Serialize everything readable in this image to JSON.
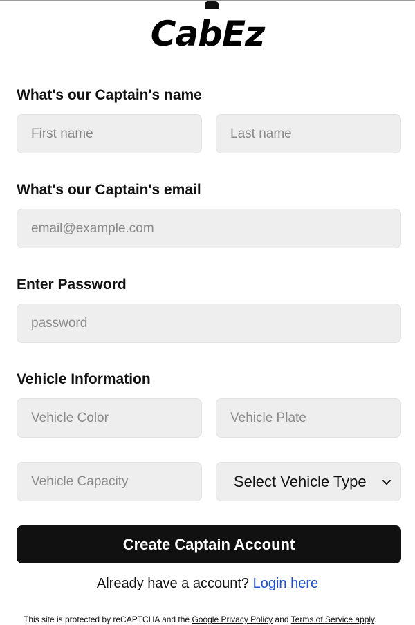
{
  "brand": {
    "name": "CabEz",
    "logo_icon": "car-icon"
  },
  "form": {
    "name_section": {
      "label": "What's our Captain's name",
      "first_name_placeholder": "First name",
      "last_name_placeholder": "Last name"
    },
    "email_section": {
      "label": "What's our Captain's email",
      "email_placeholder": "email@example.com"
    },
    "password_section": {
      "label": "Enter Password",
      "password_placeholder": "password"
    },
    "vehicle_section": {
      "label": "Vehicle Information",
      "color_placeholder": "Vehicle Color",
      "plate_placeholder": "Vehicle Plate",
      "capacity_placeholder": "Vehicle Capacity",
      "type_select_value": "Select Vehicle Type",
      "type_select_icon": "chevron-down-icon"
    },
    "submit_label": "Create Captain Account"
  },
  "footer": {
    "login_prompt": "Already have a account?",
    "login_link": "Login here",
    "recaptcha_prefix": "This site is protected by reCAPTCHA and the",
    "privacy_link": "Google Privacy Policy",
    "and_text": "and",
    "terms_link": "Terms of Service apply",
    "suffix": "."
  },
  "colors": {
    "primary_button": "#111111",
    "link": "#1e50d6",
    "field_background": "#eeeeee"
  }
}
